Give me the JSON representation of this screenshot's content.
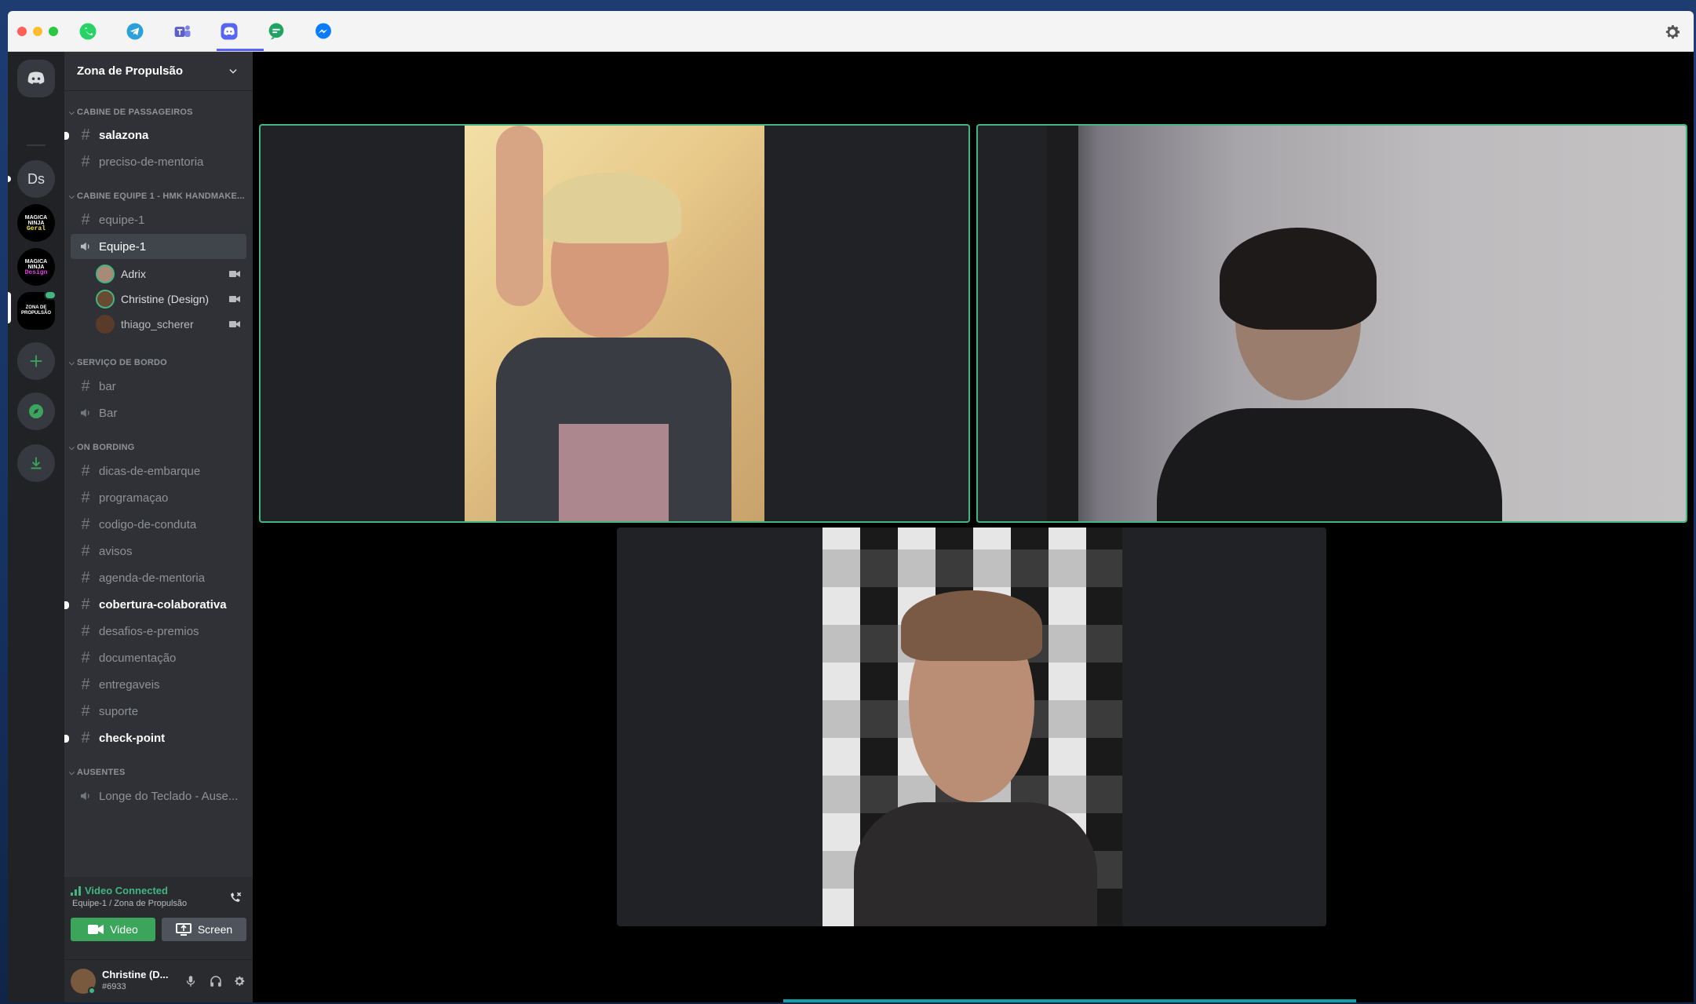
{
  "apps": [
    {
      "name": "whatsapp-icon",
      "color": "#25d366"
    },
    {
      "name": "telegram-icon",
      "color": "#2aa1da"
    },
    {
      "name": "teams-icon",
      "color": "#5b5fc7"
    },
    {
      "name": "discord-icon",
      "color": "#5865f2"
    },
    {
      "name": "chat-icon",
      "color": "#1ea362"
    },
    {
      "name": "messenger-icon",
      "color": "#0a7cff"
    }
  ],
  "guilds": {
    "ds_label": "Ds",
    "magicninja_general_lines": [
      "MAGICA",
      "NINJA",
      "Geral"
    ],
    "magicninja_design_lines": [
      "MAGICA",
      "NINJA",
      "Design"
    ],
    "zona_lines": [
      "ZONA DE",
      "PROPULSÃO"
    ]
  },
  "server": {
    "name": "Zona de Propulsão"
  },
  "categories": {
    "c1": "CABINE DE PASSAGEIROS",
    "c2": "CABINE EQUIPE 1 - HMK HANDMAKE...",
    "c3": "SERVIÇO DE BORDO",
    "c4": "ON BORDING",
    "c5": "AUSENTES"
  },
  "channels": {
    "salazona": "salazona",
    "preciso": "preciso-de-mentoria",
    "equipe1_text": "equipe-1",
    "equipe1_voice": "Equipe-1",
    "bar_text": "bar",
    "bar_voice": "Bar",
    "dicas": "dicas-de-embarque",
    "programacao": "programaçao",
    "codigo": "codigo-de-conduta",
    "avisos": "avisos",
    "agenda": "agenda-de-mentoria",
    "cobertura": "cobertura-colaborativa",
    "desafios": "desafios-e-premios",
    "documentacao": "documentação",
    "entregaveis": "entregaveis",
    "suporte": "suporte",
    "checkpoint": "check-point",
    "longe": "Longe do Teclado - Ause..."
  },
  "voice_members": [
    "Adrix",
    "Christine (Design)",
    "thiago_scherer"
  ],
  "voice_panel": {
    "status": "Video Connected",
    "location": "Equipe-1 / Zona de Propulsão",
    "video_label": "Video",
    "screen_label": "Screen"
  },
  "user": {
    "name": "Christine (D...",
    "tag": "#6933"
  },
  "colors": {
    "online": "#43b581",
    "accent": "#5865f2"
  }
}
